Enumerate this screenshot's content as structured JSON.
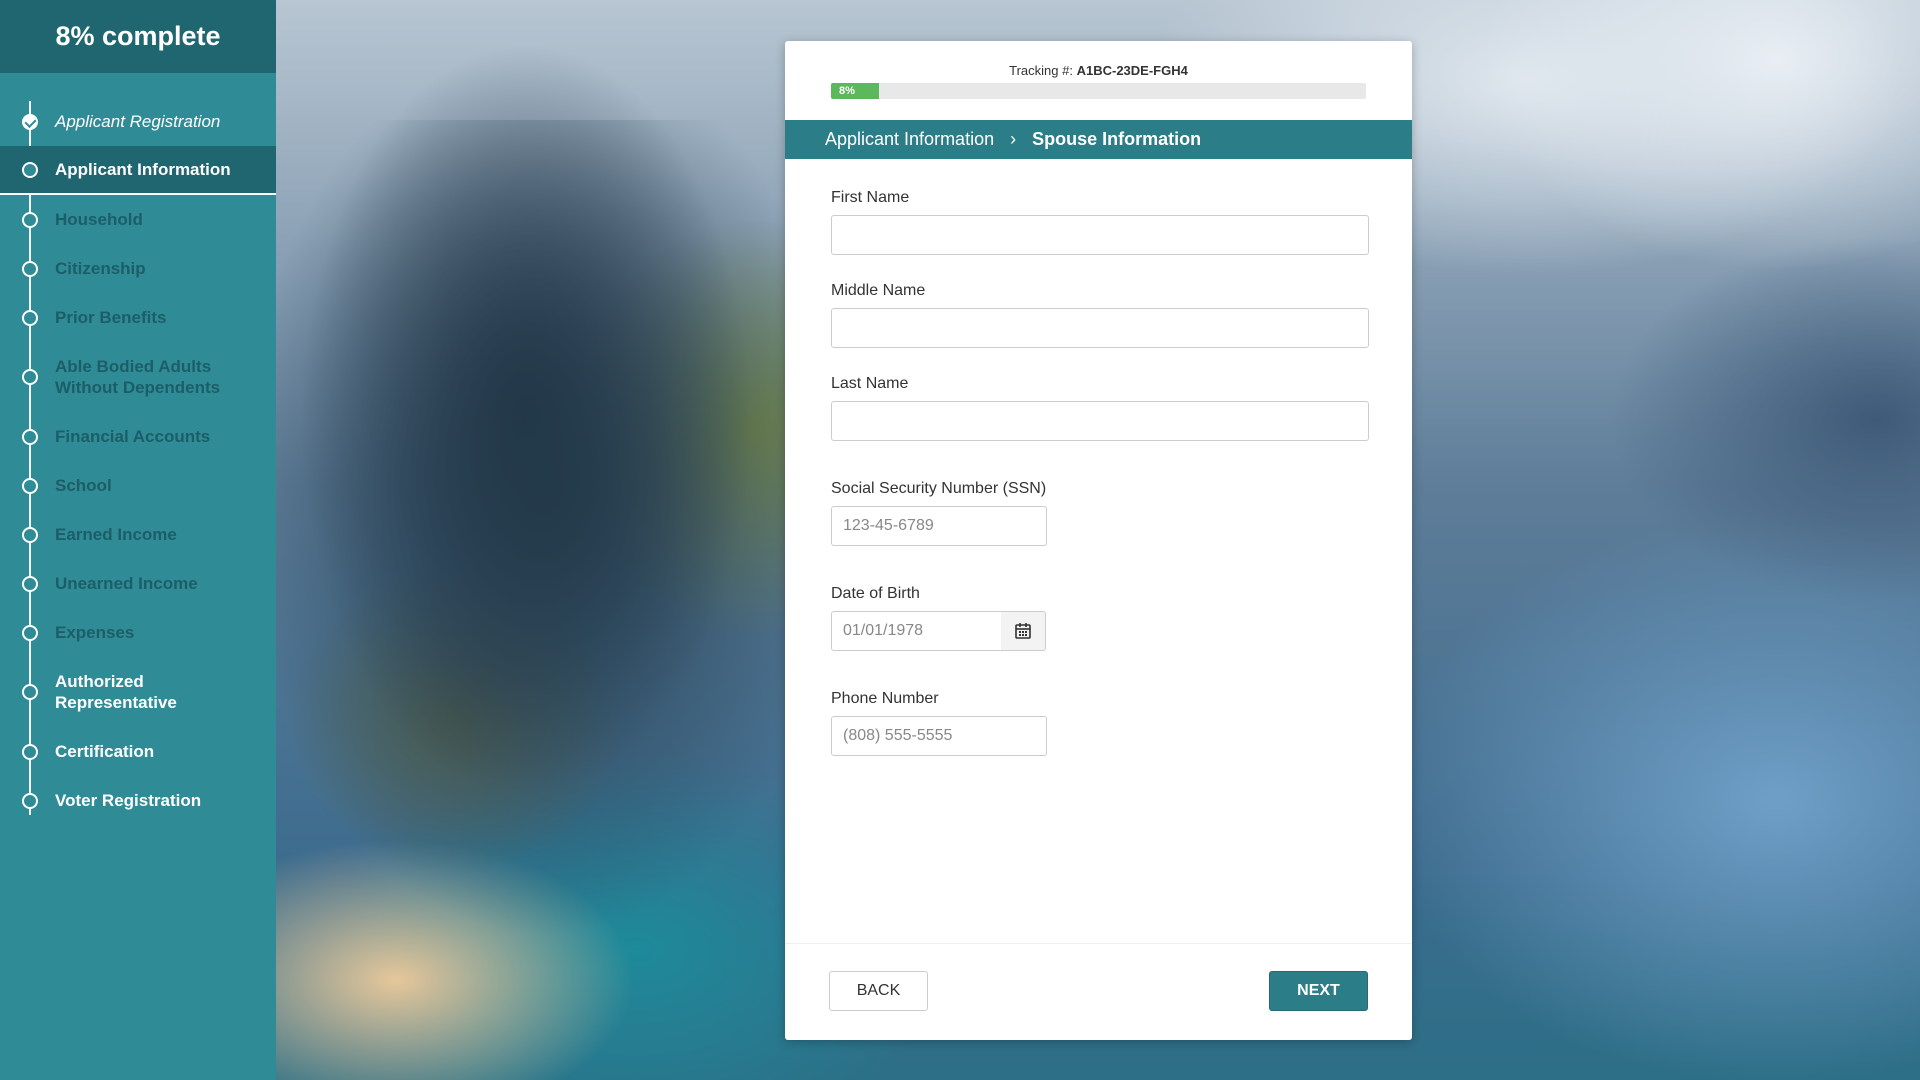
{
  "progress": {
    "label": "8% complete",
    "percent": 8,
    "bar_label": "8%"
  },
  "sidebar": {
    "items": [
      {
        "label": "Applicant Registration",
        "state": "done"
      },
      {
        "label": "Applicant Information",
        "state": "active"
      },
      {
        "label": "Household",
        "state": "pending"
      },
      {
        "label": "Citizenship",
        "state": "pending"
      },
      {
        "label": "Prior Benefits",
        "state": "pending"
      },
      {
        "label": "Able Bodied Adults Without Dependents",
        "state": "pending"
      },
      {
        "label": "Financial Accounts",
        "state": "pending"
      },
      {
        "label": "School",
        "state": "pending"
      },
      {
        "label": "Earned Income",
        "state": "pending"
      },
      {
        "label": "Unearned Income",
        "state": "pending"
      },
      {
        "label": "Expenses",
        "state": "pending"
      },
      {
        "label": "Authorized Representative",
        "state": "pending"
      },
      {
        "label": "Certification",
        "state": "pending"
      },
      {
        "label": "Voter Registration",
        "state": "pending"
      }
    ]
  },
  "tracking": {
    "prefix": "Tracking #:",
    "number": "A1BC-23DE-FGH4"
  },
  "breadcrumb": {
    "parent": "Applicant Information",
    "separator": "›",
    "current": "Spouse Information"
  },
  "form": {
    "first_name": {
      "label": "First Name",
      "value": "",
      "placeholder": ""
    },
    "middle_name": {
      "label": "Middle Name",
      "value": "",
      "placeholder": ""
    },
    "last_name": {
      "label": "Last Name",
      "value": "",
      "placeholder": ""
    },
    "ssn": {
      "label": "Social Security Number (SSN)",
      "value": "",
      "placeholder": "123-45-6789"
    },
    "dob": {
      "label": "Date of Birth",
      "value": "",
      "placeholder": "01/01/1978",
      "icon": "calendar-icon"
    },
    "phone": {
      "label": "Phone Number",
      "value": "",
      "placeholder": "(808) 555-5555"
    }
  },
  "buttons": {
    "back": "BACK",
    "next": "NEXT"
  },
  "colors": {
    "sidebar": "#2f8c96",
    "sidebar_header": "#1f6670",
    "accent": "#2b7d87",
    "progress": "#5cb85c"
  }
}
